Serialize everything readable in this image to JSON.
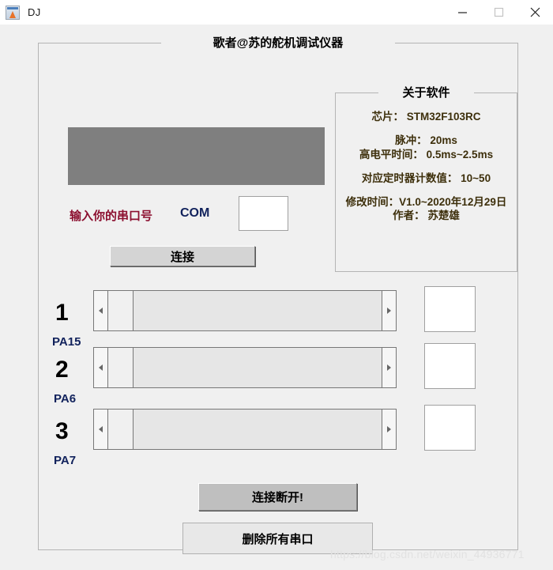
{
  "window": {
    "title": "DJ",
    "icon": "matlab-icon",
    "controls": {
      "minimize": "minimize-icon",
      "maximize": "maximize-icon",
      "close": "close-icon"
    }
  },
  "main_panel": {
    "title": "歌者@苏的舵机调试仪器"
  },
  "serial": {
    "prompt_label": "输入你的串口号",
    "com_label": "COM",
    "com_value": "",
    "com_placeholder": "",
    "connect_button": "连接"
  },
  "about": {
    "title": "关于软件",
    "lines": [
      "芯片： STM32F103RC",
      "脉冲： 20ms",
      "高电平时间： 0.5ms~2.5ms",
      "对应定时器计数值： 10~50",
      "修改时间：V1.0~2020年12月29日",
      "作者： 苏楚雄"
    ],
    "chip": "芯片： STM32F103RC",
    "pulse": "脉冲： 20ms",
    "high_level": "高电平时间： 0.5ms~2.5ms",
    "timer_count": "对应定时器计数值： 10~50",
    "modified": "修改时间：V1.0~2020年12月29日",
    "author": "作者： 苏楚雄"
  },
  "channels": [
    {
      "number": "1",
      "pin": "PA15",
      "value": "",
      "slider_position_pct": 0
    },
    {
      "number": "2",
      "pin": "PA6",
      "value": "",
      "slider_position_pct": 0
    },
    {
      "number": "3",
      "pin": "PA7",
      "value": "",
      "slider_position_pct": 0
    }
  ],
  "actions": {
    "disconnect_button": "连接断开!",
    "delete_ports_button": "删除所有串口"
  },
  "watermark": "https://blog.csdn.net/weixin_44936771",
  "colors": {
    "prompt_red": "#8c1030",
    "com_navy": "#11225c",
    "pin_navy": "#11225c",
    "about_text": "#3d2f0b",
    "axes_gray": "#7f7f7f",
    "window_bg": "#f0f0f0"
  }
}
